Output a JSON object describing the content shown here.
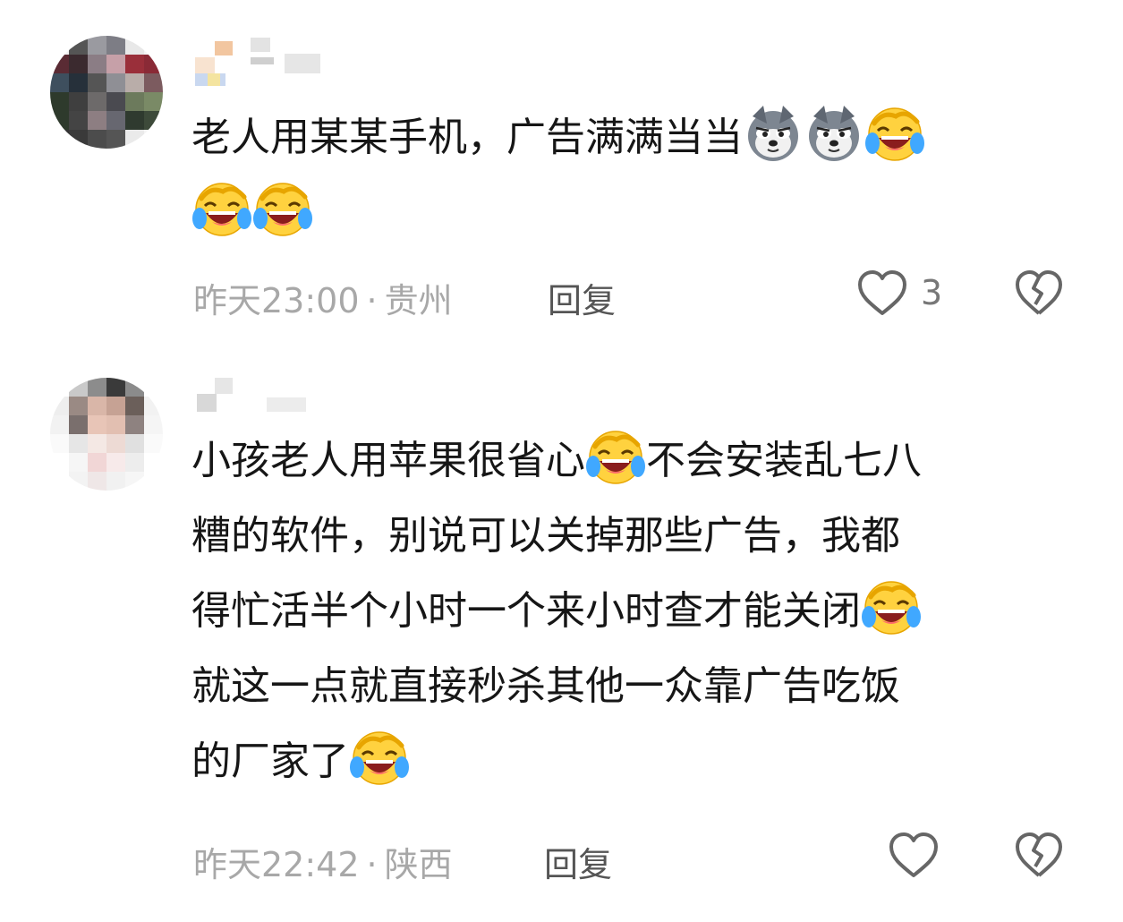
{
  "comments": [
    {
      "avatar_icon": "pixelated-avatar",
      "username_icon": "pixelated-username",
      "lines": [
        [
          {
            "t": "text",
            "v": "老人用某某手机，广告满满当当"
          },
          {
            "t": "emoji",
            "v": "doge-emoji"
          },
          {
            "t": "emoji",
            "v": "doge-emoji"
          },
          {
            "t": "emoji",
            "v": "laugh-cry-emoji"
          }
        ],
        [
          {
            "t": "emoji",
            "v": "laugh-cry-emoji"
          },
          {
            "t": "emoji",
            "v": "laugh-cry-emoji"
          }
        ]
      ],
      "time": "昨天23:00",
      "location": "贵州",
      "reply": "回复",
      "likes": "3"
    },
    {
      "avatar_icon": "pixelated-avatar",
      "username_icon": "pixelated-username",
      "lines": [
        [
          {
            "t": "text",
            "v": "小孩老人用苹果很省心"
          },
          {
            "t": "emoji",
            "v": "laugh-cry-emoji"
          },
          {
            "t": "text",
            "v": "不会安装乱七八"
          }
        ],
        [
          {
            "t": "text",
            "v": "糟的软件，别说可以关掉那些广告，我都"
          }
        ],
        [
          {
            "t": "text",
            "v": "得忙活半个小时一个来小时查才能关闭"
          },
          {
            "t": "emoji",
            "v": "laugh-cry-emoji"
          }
        ],
        [
          {
            "t": "text",
            "v": "就这一点就直接秒杀其他一众靠广告吃饭"
          }
        ],
        [
          {
            "t": "text",
            "v": "的厂家了"
          },
          {
            "t": "emoji",
            "v": "laugh-cry-emoji"
          }
        ]
      ],
      "time": "昨天22:42",
      "location": "陕西",
      "reply": "回复",
      "likes": ""
    }
  ],
  "meta_separator": "·",
  "icons": {
    "like": "heart-outline-icon",
    "dislike": "broken-heart-icon"
  },
  "colors": {
    "text": "#161616",
    "meta": "#a8a8a8",
    "reply": "#555555",
    "icon_stroke": "#666666"
  }
}
